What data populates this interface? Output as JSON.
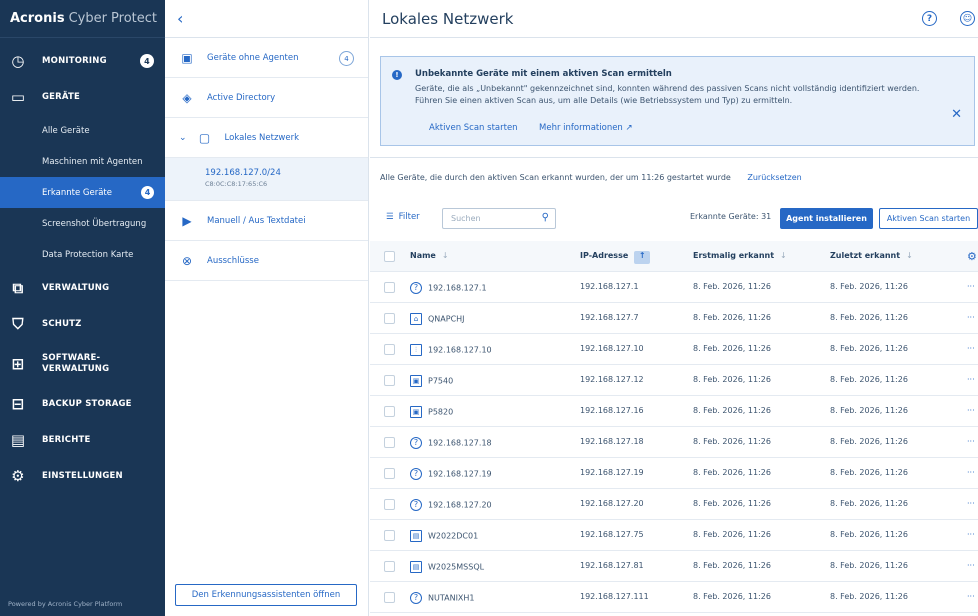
{
  "sidebar": {
    "brand": "Acronis",
    "product": "Cyber Protect",
    "items": [
      {
        "label": "MONITORING",
        "icon": "monitoring-gauge-icon",
        "badge": "4"
      },
      {
        "label": "GERÄTE",
        "icon": "monitor-icon"
      }
    ],
    "sub_items": [
      {
        "label": "Alle Geräte"
      },
      {
        "label": "Maschinen mit Agenten"
      },
      {
        "label": "Erkannte Geräte",
        "badge": "4"
      },
      {
        "label": "Screenshot Übertragung"
      },
      {
        "label": "Data Protection Karte"
      }
    ],
    "more_items": [
      {
        "label": "VERWALTUNG",
        "icon": "management-icon"
      },
      {
        "label": "SCHUTZ",
        "icon": "shield-icon"
      },
      {
        "label": "SOFTWARE-VERWALTUNG",
        "label_line1": "SOFTWARE-",
        "label_line2": "VERWALTUNG",
        "icon": "software-icon"
      },
      {
        "label": "BACKUP STORAGE",
        "icon": "storage-icon"
      },
      {
        "label": "BERICHTE",
        "icon": "reports-icon"
      },
      {
        "label": "EINSTELLUNGEN",
        "icon": "settings-gear-icon"
      }
    ],
    "footer": "Powered by Acronis Cyber Platform"
  },
  "middle": {
    "items": [
      {
        "label": "Geräte ohne Agenten",
        "count": "4",
        "icon": "device-icon"
      },
      {
        "label": "Active Directory",
        "icon": "directory-icon"
      },
      {
        "label": "Lokales Netzwerk",
        "icon": "network-folder-icon"
      },
      {
        "label": "Manuell / Aus Textdatei",
        "icon": "text-file-icon"
      },
      {
        "label": "Ausschlüsse",
        "icon": "exclusion-icon"
      }
    ],
    "subnet": {
      "ip": "192.168.127.0/24",
      "mac": "C8:0C:C8:17:65:C6"
    },
    "wizard_button": "Den Erkennungsassistenten öffnen"
  },
  "main": {
    "title": "Lokales Netzwerk",
    "info": {
      "title": "Unbekannte Geräte mit einem aktiven Scan ermitteln",
      "text": "Geräte, die als „Unbekannt\" gekennzeichnet sind, konnten während des passiven Scans nicht vollständig identifiziert werden. Führen Sie einen aktiven Scan aus, um alle Details (wie Betriebssystem und Typ) zu ermitteln.",
      "link1": "Aktiven Scan starten",
      "link2": "Mehr informationen ↗"
    },
    "scan_text": "Alle Geräte, die durch den aktiven Scan erkannt wurden, der um 11:26 gestartet wurde",
    "reset_link": "Zurücksetzen",
    "filter_label": "Filter",
    "search_placeholder": "Suchen",
    "found_label": "Erkannte Geräte: 31",
    "install_button": "Agent installieren",
    "scan_button": "Aktiven Scan starten"
  },
  "table": {
    "headers": {
      "name": "Name",
      "ip": "IP-Adresse",
      "first": "Erstmalig erkannt",
      "last": "Zuletzt erkannt"
    },
    "rows": [
      {
        "name": "192.168.127.1",
        "ip": "192.168.127.1",
        "first": "8. Feb. 2026, 11:26",
        "last": "8. Feb. 2026, 11:26",
        "icon": "unknown-device-icon"
      },
      {
        "name": "QNAPCHJ",
        "ip": "192.168.127.7",
        "first": "8. Feb. 2026, 11:26",
        "last": "8. Feb. 2026, 11:26",
        "icon": "nas-icon"
      },
      {
        "name": "192.168.127.10",
        "ip": "192.168.127.10",
        "first": "8. Feb. 2026, 11:26",
        "last": "8. Feb. 2026, 11:26",
        "icon": "network-switch-icon"
      },
      {
        "name": "P7540",
        "ip": "192.168.127.12",
        "first": "8. Feb. 2026, 11:26",
        "last": "8. Feb. 2026, 11:26",
        "icon": "workstation-icon"
      },
      {
        "name": "P5820",
        "ip": "192.168.127.16",
        "first": "8. Feb. 2026, 11:26",
        "last": "8. Feb. 2026, 11:26",
        "icon": "workstation-icon"
      },
      {
        "name": "192.168.127.18",
        "ip": "192.168.127.18",
        "first": "8. Feb. 2026, 11:26",
        "last": "8. Feb. 2026, 11:26",
        "icon": "unknown-device-icon"
      },
      {
        "name": "192.168.127.19",
        "ip": "192.168.127.19",
        "first": "8. Feb. 2026, 11:26",
        "last": "8. Feb. 2026, 11:26",
        "icon": "unknown-device-icon"
      },
      {
        "name": "192.168.127.20",
        "ip": "192.168.127.20",
        "first": "8. Feb. 2026, 11:26",
        "last": "8. Feb. 2026, 11:26",
        "icon": "unknown-device-icon"
      },
      {
        "name": "W2022DC01",
        "ip": "192.168.127.75",
        "first": "8. Feb. 2026, 11:26",
        "last": "8. Feb. 2026, 11:26",
        "icon": "server-icon"
      },
      {
        "name": "W2025MSSQL",
        "ip": "192.168.127.81",
        "first": "8. Feb. 2026, 11:26",
        "last": "8. Feb. 2026, 11:26",
        "icon": "server-icon"
      },
      {
        "name": "NUTANIXH1",
        "ip": "192.168.127.111",
        "first": "8. Feb. 2026, 11:26",
        "last": "8. Feb. 2026, 11:26",
        "icon": "unknown-device-icon"
      }
    ]
  },
  "colors": {
    "sidebar": "#1a3655",
    "accent": "#2668c5",
    "info_bg": "#e9f1fb"
  }
}
